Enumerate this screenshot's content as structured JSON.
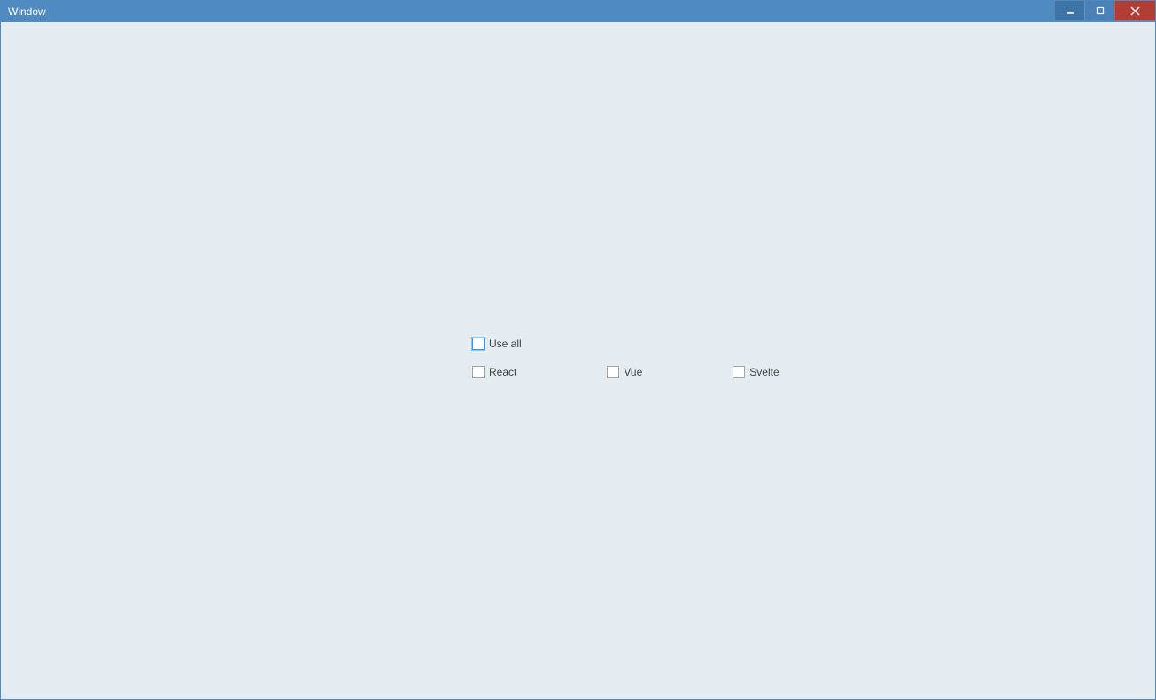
{
  "window": {
    "title": "Window"
  },
  "checkboxes": {
    "useAll": "Use all",
    "react": "React",
    "vue": "Vue",
    "svelte": "Svelte"
  }
}
